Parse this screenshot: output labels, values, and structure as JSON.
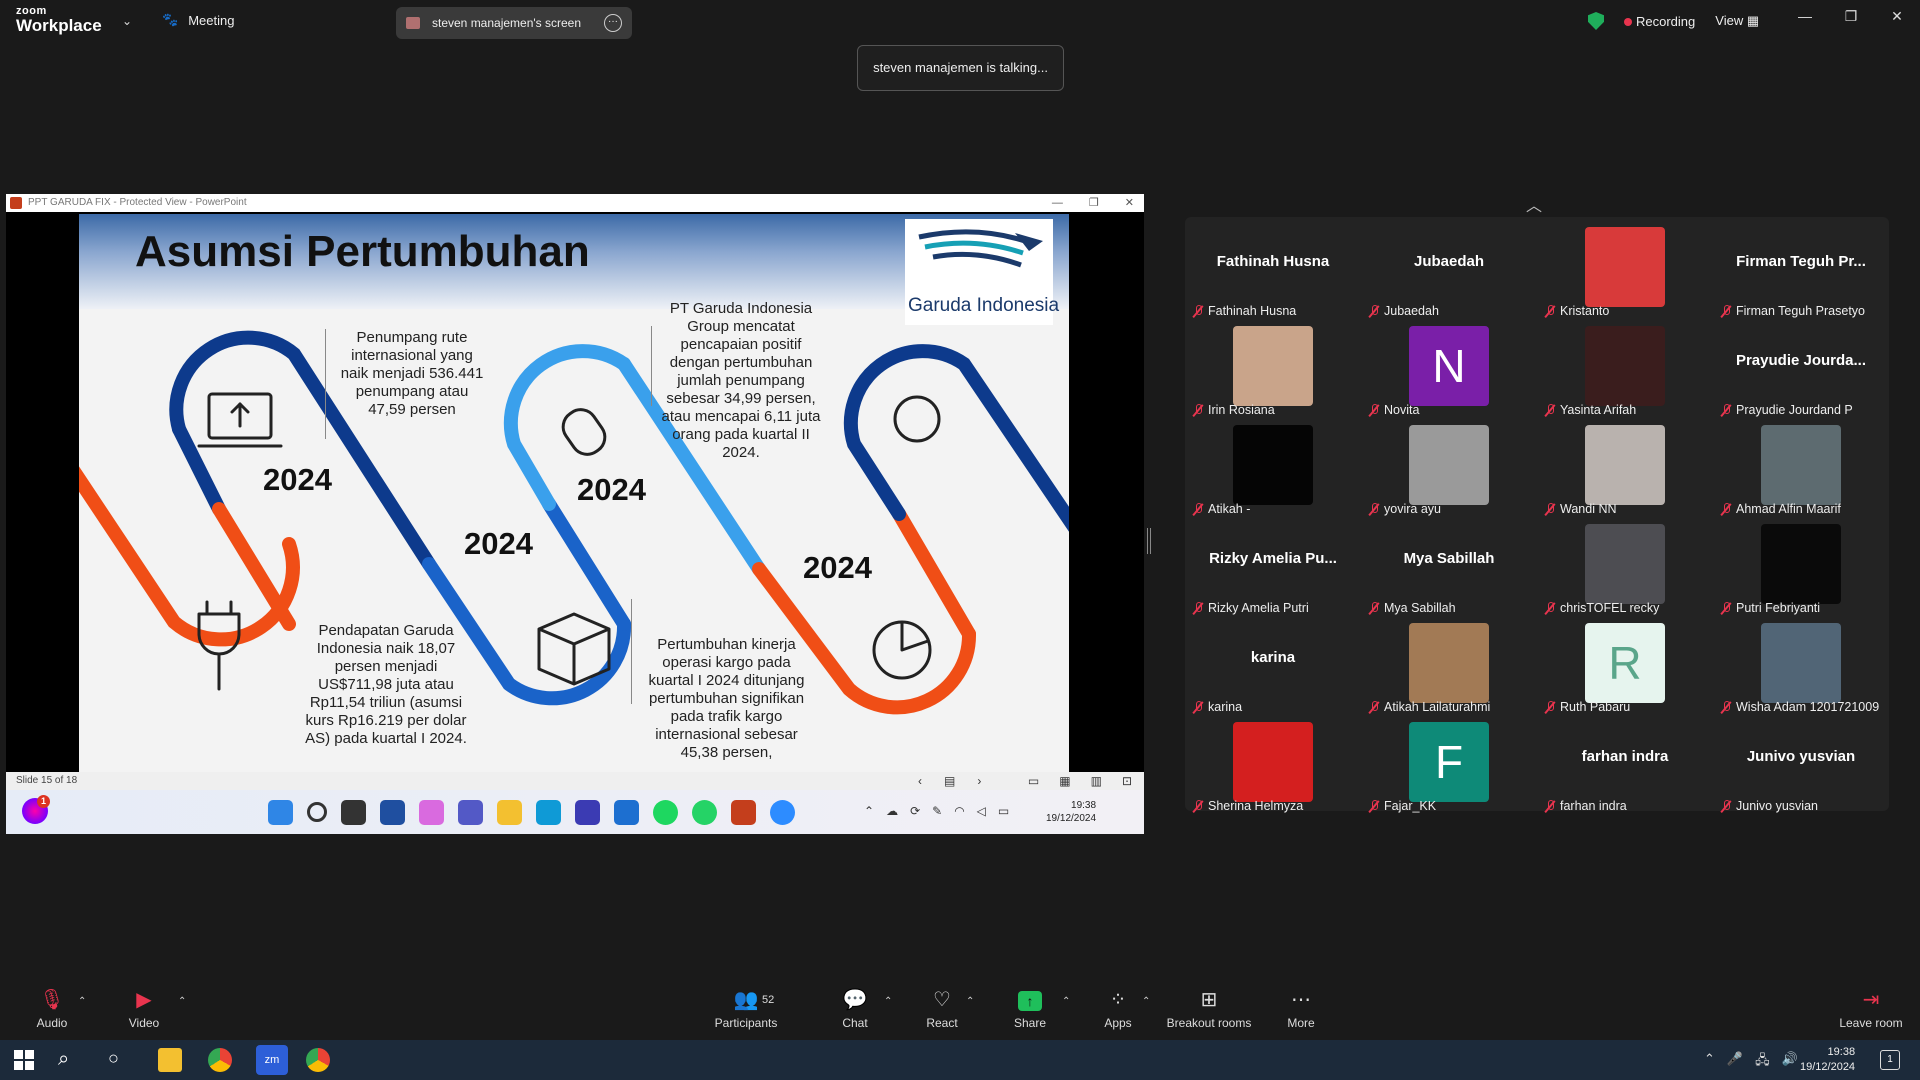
{
  "app": {
    "logo_top": "zoom",
    "logo_bottom": "Workplace",
    "meeting_label": "Meeting",
    "share_label": "steven manajemen's screen",
    "recording_label": "Recording",
    "view_label": "View"
  },
  "talking": "steven manajemen is talking...",
  "ppt": {
    "window_title": "PPT GARUDA FIX  -  Protected View  -  PowerPoint",
    "status": "Slide 15 of 18",
    "heading": "Asumsi Pertumbuhan",
    "logo_text": "Garuda Indonesia",
    "years": [
      "2024",
      "2024",
      "2024",
      "2024"
    ],
    "texts": [
      "Penumpang rute internasional yang naik menjadi 536.441 penumpang atau 47,59 persen",
      "PT Garuda Indonesia Group mencatat pencapaian positif dengan pertumbuhan jumlah penumpang sebesar 34,99 persen, atau mencapai 6,11 juta orang pada kuartal II 2024.",
      "Pendapatan Garuda Indonesia naik 18,07 persen menjadi US$711,98 juta atau Rp11,54 triliun (asumsi kurs Rp16.219 per dolar AS) pada kuartal I 2024.",
      "Pertumbuhan kinerja operasi kargo pada kuartal I 2024 ditunjang pertumbuhan signifikan pada trafik kargo internasional sebesar 45,38 persen,"
    ],
    "clock_time": "19:38",
    "clock_date": "19/12/2024",
    "taskbar_badge": "1"
  },
  "participants": [
    {
      "name": "Fathinah Husna",
      "label": "Fathinah Husna",
      "kind": "name"
    },
    {
      "name": "Jubaedah",
      "label": "Jubaedah",
      "kind": "name"
    },
    {
      "name": "",
      "label": "Kristanto",
      "kind": "photo",
      "color": "#d83a3a"
    },
    {
      "name": "Firman Teguh Pr...",
      "label": "Firman Teguh Prasetyo",
      "kind": "name"
    },
    {
      "name": "",
      "label": "Irin Rosiana",
      "kind": "photo",
      "color": "#c9a48a"
    },
    {
      "name": "N",
      "label": "Novita",
      "kind": "initial",
      "color": "#7a1fa8"
    },
    {
      "name": "",
      "label": "Yasinta Arifah",
      "kind": "photo",
      "color": "#3a1d1d"
    },
    {
      "name": "Prayudie Jourda...",
      "label": "Prayudie Jourdand P",
      "kind": "name"
    },
    {
      "name": "",
      "label": "Atikah -",
      "kind": "photo",
      "color": "#050505"
    },
    {
      "name": "",
      "label": "yovira ayu",
      "kind": "photo",
      "color": "#9a9a9a"
    },
    {
      "name": "",
      "label": "Wandi NN",
      "kind": "photo",
      "color": "#b9b2ae"
    },
    {
      "name": "",
      "label": "Ahmad Alfin Maarif",
      "kind": "photo",
      "color": "#5d6b70"
    },
    {
      "name": "Rizky Amelia Pu...",
      "label": "Rizky Amelia Putri",
      "kind": "name"
    },
    {
      "name": "Mya Sabillah",
      "label": "Mya Sabillah",
      "kind": "name"
    },
    {
      "name": "",
      "label": "chrisTOFEL recky",
      "kind": "photo",
      "color": "#4d4d52"
    },
    {
      "name": "",
      "label": "Putri Febriyanti",
      "kind": "photo",
      "color": "#0a0a0a"
    },
    {
      "name": "karina",
      "label": "karina",
      "kind": "name"
    },
    {
      "name": "",
      "label": "Atikah Lailaturahmi",
      "kind": "photo",
      "color": "#a27a55"
    },
    {
      "name": "R",
      "label": "Ruth Pabaru",
      "kind": "initial",
      "color": "#e6f4ee"
    },
    {
      "name": "",
      "label": "Wisha Adam 1201721009",
      "kind": "photo",
      "color": "#516576"
    },
    {
      "name": "",
      "label": "Sherina Helmyza",
      "kind": "photo",
      "color": "#d41f1f"
    },
    {
      "name": "F",
      "label": "Fajar_KK",
      "kind": "initial",
      "color": "#0e8a78"
    },
    {
      "name": "farhan indra",
      "label": "farhan indra",
      "kind": "name"
    },
    {
      "name": "Junivo yusvian",
      "label": "Junivo yusvian",
      "kind": "name"
    }
  ],
  "toolbar": {
    "audio": "Audio",
    "video": "Video",
    "participants": "Participants",
    "participants_count": "52",
    "chat": "Chat",
    "react": "React",
    "share": "Share",
    "apps": "Apps",
    "breakout": "Breakout rooms",
    "more": "More",
    "leave": "Leave room"
  },
  "taskbar": {
    "time": "19:38",
    "date": "19/12/2024",
    "notif": "1"
  }
}
